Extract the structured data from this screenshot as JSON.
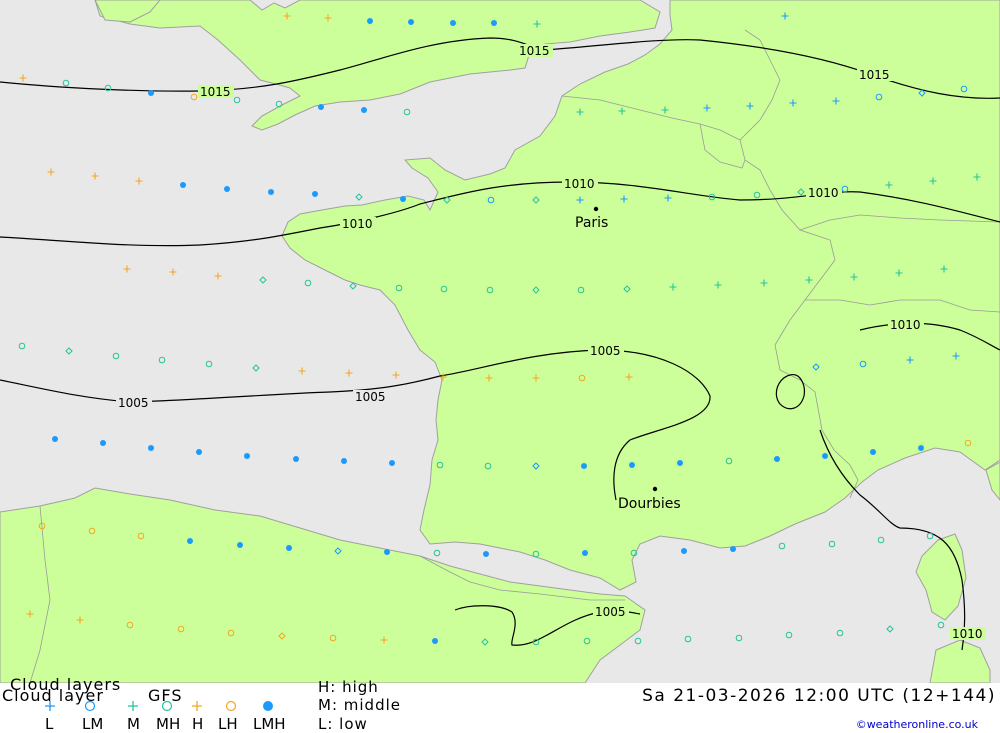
{
  "colors": {
    "sea": "#e8e8e8",
    "land": "#ccff99",
    "coast": "#a0a0a0",
    "isobar": "#000000",
    "high_cloud": "#1a9bfc",
    "middle_cloud": "#23c49c",
    "low_cloud": "#f5a623"
  },
  "isobars": [
    {
      "value": "1015"
    },
    {
      "value": "1015"
    },
    {
      "value": "1015"
    },
    {
      "value": "1010"
    },
    {
      "value": "1010"
    },
    {
      "value": "1010"
    },
    {
      "value": "1010"
    },
    {
      "value": "1010"
    },
    {
      "value": "1005"
    },
    {
      "value": "1005"
    },
    {
      "value": "1005"
    },
    {
      "value": "1005"
    }
  ],
  "cities": [
    {
      "name": "Paris"
    },
    {
      "name": "Dourbies"
    }
  ],
  "legend": {
    "title_line1": "Cloud layers",
    "title_line2": "Cloud layer",
    "model": "GFS",
    "symbols": [
      {
        "code": "L",
        "icon": "plus-icon",
        "color": "#1a9bfc"
      },
      {
        "code": "LM",
        "icon": "circle-icon",
        "color": "#1a9bfc"
      },
      {
        "code": "M",
        "icon": "plus-icon",
        "color": "#23c49c"
      },
      {
        "code": "MH",
        "icon": "circle-icon",
        "color": "#23c49c"
      },
      {
        "code": "H",
        "icon": "plus-icon",
        "color": "#f5a623"
      },
      {
        "code": "LH",
        "icon": "circle-icon",
        "color": "#f5a623"
      },
      {
        "code": "LMH",
        "icon": "filled-circle-icon",
        "color": "#1a9bfc"
      }
    ],
    "key_high": "H:  high",
    "key_middle": "M:  middle",
    "key_low": "L:  low",
    "datetime": "Sa 21-03-2026 12:00 UTC (12+144)",
    "credit": "©weatheronline.co.uk"
  }
}
